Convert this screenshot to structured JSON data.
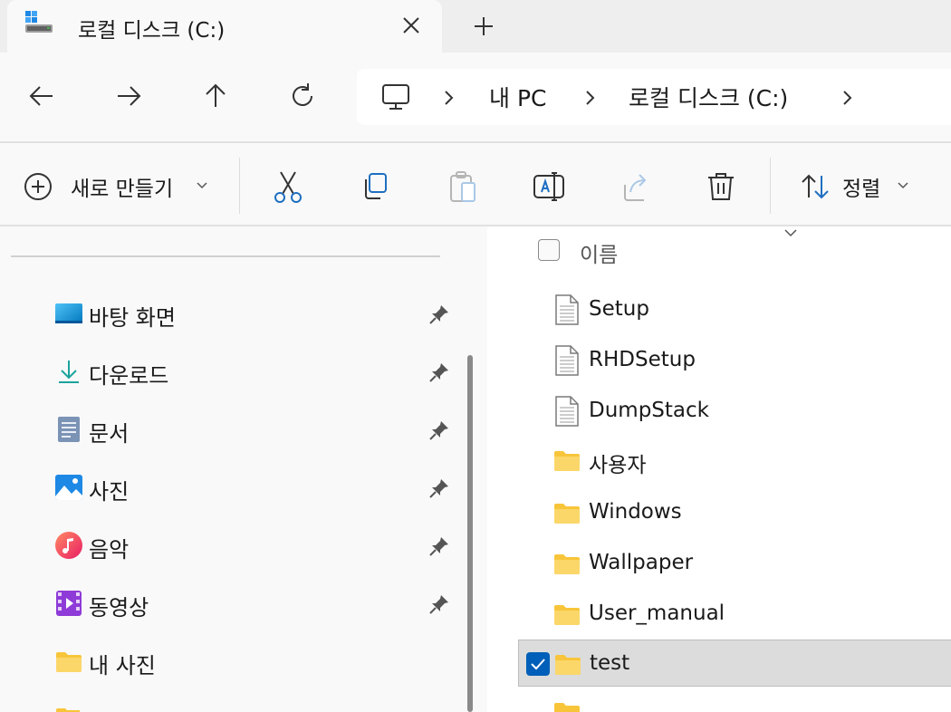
{
  "window": {
    "tab_title": "로컬 디스크 (C:)",
    "tab_icon": "drive-icon",
    "new_tab_symbol": "+"
  },
  "breadcrumb": {
    "items": [
      "내 PC",
      "로컬 디스크 (C:)"
    ],
    "root_icon": "monitor-icon"
  },
  "toolbar": {
    "new_label": "새로 만들기",
    "sort_label": "정렬"
  },
  "sidebar": {
    "items": [
      {
        "label": "바탕 화면",
        "icon": "desktop-icon",
        "pinned": true
      },
      {
        "label": "다운로드",
        "icon": "download-icon",
        "pinned": true
      },
      {
        "label": "문서",
        "icon": "documents-icon",
        "pinned": true
      },
      {
        "label": "사진",
        "icon": "pictures-icon",
        "pinned": true
      },
      {
        "label": "음악",
        "icon": "music-icon",
        "pinned": true
      },
      {
        "label": "동영상",
        "icon": "videos-icon",
        "pinned": true
      },
      {
        "label": "내 사진",
        "icon": "folder-icon",
        "pinned": false
      }
    ]
  },
  "file_list": {
    "column_name": "이름",
    "rows": [
      {
        "name": "Setup",
        "type": "file",
        "selected": false
      },
      {
        "name": "RHDSetup",
        "type": "file",
        "selected": false
      },
      {
        "name": "DumpStack",
        "type": "file",
        "selected": false
      },
      {
        "name": "사용자",
        "type": "folder",
        "selected": false
      },
      {
        "name": "Windows",
        "type": "folder",
        "selected": false
      },
      {
        "name": "Wallpaper",
        "type": "folder",
        "selected": false
      },
      {
        "name": "User_manual",
        "type": "folder",
        "selected": false
      },
      {
        "name": "test",
        "type": "folder",
        "selected": true
      }
    ]
  },
  "colors": {
    "accent": "#005fb8",
    "folder": "#f8c53a",
    "selection": "#dcdcdc"
  }
}
